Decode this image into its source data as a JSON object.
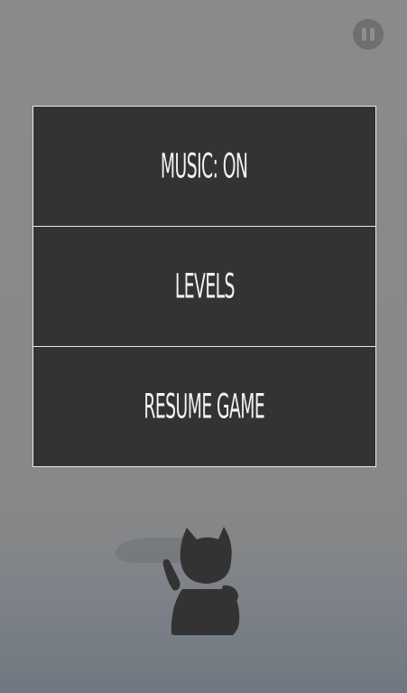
{
  "menu": {
    "music_label": "MUSIC: ON",
    "levels_label": "LEVELS",
    "resume_label": "RESUME GAME"
  },
  "icons": {
    "pause": "pause-icon",
    "character": "lucky-cat-silhouette"
  },
  "colors": {
    "background_top": "#8a8a8a",
    "background_bottom": "#717780",
    "menu_background": "#333333",
    "menu_border": "#e8e8e8",
    "menu_text": "#f2f2f2",
    "pause_button": "#6f6f6f",
    "pause_bars": "#8f8f8f",
    "character": "#333333"
  }
}
